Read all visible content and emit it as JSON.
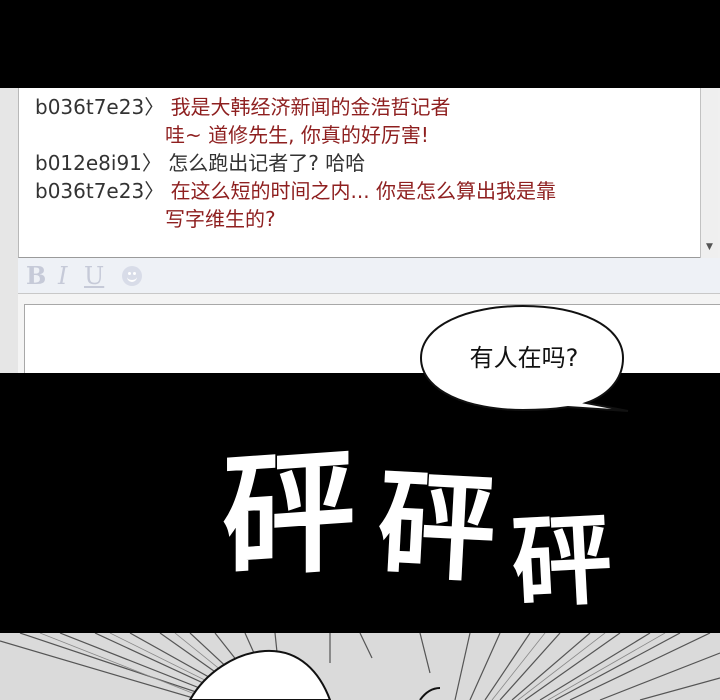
{
  "chat": {
    "messages": [
      {
        "user": "b036t7e23〉",
        "text": "我是大韩经济新闻的金浩哲记者",
        "cont": "哇~ 道修先生, 你真的好厉害!"
      },
      {
        "user": "b012e8i91〉",
        "text": "怎么跑出记者了? 哈哈"
      },
      {
        "user": "b036t7e23〉",
        "text": "在这么短的时间之内... 你是怎么算出我是靠",
        "cont": "写字维生的?"
      }
    ]
  },
  "toolbar": {
    "bold_label": "B",
    "italic_label": "I",
    "underline_label": "U"
  },
  "bubble": {
    "text": "有人在吗?"
  },
  "sfx": {
    "first": "砰",
    "second": "砰",
    "third": "砰"
  },
  "colors": {
    "message_text": "#8e1f1f",
    "username_text": "#333333",
    "toolbar_glyph": "#c6cad8"
  },
  "icons": {
    "smiley": "smiley-icon",
    "scroll_down": "scroll-down-arrow-icon"
  }
}
